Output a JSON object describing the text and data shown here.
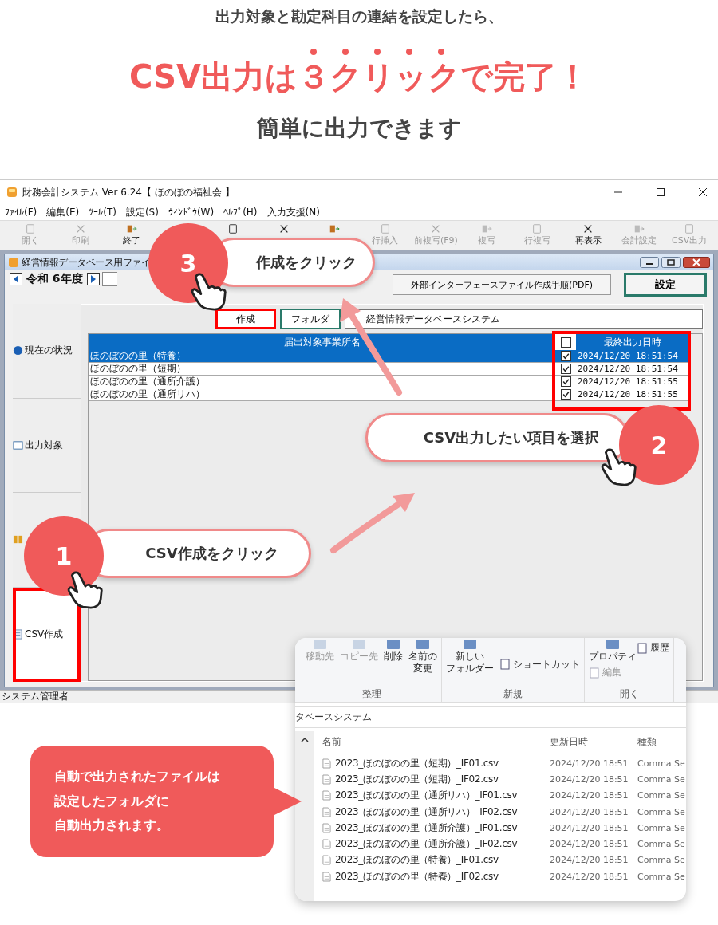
{
  "header": {
    "lead": "出力対象と勘定科目の連結を設定したら、",
    "title_parts": [
      {
        "text": "CSV出力は",
        "emphasis": false
      },
      {
        "text": "３クリック",
        "emphasis": true
      },
      {
        "text": "で完了！",
        "emphasis": false
      }
    ],
    "subtitle": "簡単に出力できます"
  },
  "app": {
    "title": "財務会計システム Ver 6.24【 ほのぼの福祉会 】",
    "menus": [
      "ﾌｧｲﾙ(F)",
      "編集(E)",
      "ﾂｰﾙ(T)",
      "設定(S)",
      "ｳｨﾝﾄﾞｳ(W)",
      "ﾍﾙﾌﾟ(H)",
      "入力支援(N)"
    ],
    "toolbar": [
      {
        "label": "開く",
        "disabled": true
      },
      {
        "label": "印刷",
        "disabled": true
      },
      {
        "label": "終了",
        "disabled": false
      },
      {
        "disabled": false
      },
      {
        "disabled": false
      },
      {
        "disabled": false
      },
      {
        "label": "行挿入",
        "disabled": true
      },
      {
        "label": "前複写(F9)",
        "disabled": true
      },
      {
        "label": "複写",
        "disabled": true
      },
      {
        "label": "行複写",
        "disabled": true
      },
      {
        "label": "再表示",
        "disabled": false
      },
      {
        "label": "会計設定",
        "disabled": true
      },
      {
        "label": "CSV出力",
        "disabled": true
      }
    ],
    "status": "システム管理者"
  },
  "child": {
    "title": "経営情報データベース用ファイ",
    "year": "令和 6年度",
    "pdf_button": "外部インターフェースファイル作成手順(PDF)",
    "settings_button": "設定",
    "sidebar": [
      {
        "label": "現在の状況",
        "selected": false,
        "highlighted": false
      },
      {
        "label": "出力対象",
        "selected": false,
        "highlighted": false
      },
      {
        "selected": false,
        "highlighted": false
      },
      {
        "label": "CSV作成",
        "selected": true,
        "highlighted": true
      }
    ],
    "actions": [
      {
        "label": "作成",
        "highlighted": true
      },
      {
        "label": "フォルダ",
        "highlighted": false
      }
    ],
    "folder_path": "経営情報データベースシステム",
    "table": {
      "columns": [
        "届出対象事業所名",
        "最終出力日時"
      ],
      "all_checked": false,
      "output_columns_highlighted": true,
      "rows": [
        {
          "name": "ほのぼのの里（特養）",
          "checked": true,
          "date": "2024/12/20 18:51:54",
          "selected": true
        },
        {
          "name": "ほのぼのの里（短期）",
          "checked": true,
          "date": "2024/12/20 18:51:54",
          "selected": false
        },
        {
          "name": "ほのぼのの里（通所介護）",
          "checked": true,
          "date": "2024/12/20 18:51:55",
          "selected": false
        },
        {
          "name": "ほのぼのの里（通所リハ）",
          "checked": true,
          "date": "2024/12/20 18:51:55",
          "selected": false
        }
      ]
    }
  },
  "steps": [
    {
      "number": "3",
      "text": "作成をクリック"
    },
    {
      "number": "2",
      "text": "CSV出力したい項目を選択"
    },
    {
      "number": "1",
      "text": "CSV作成をクリック"
    }
  ],
  "explorer": {
    "ribbon_groups": [
      {
        "label": "整理",
        "commands": [
          {
            "lines": [
              "移動先"
            ],
            "disabled": true,
            "kind": "large"
          },
          {
            "lines": [
              "コピー先"
            ],
            "disabled": true,
            "kind": "large"
          },
          {
            "lines": [
              "削除"
            ],
            "disabled": false,
            "kind": "large"
          },
          {
            "lines": [
              "名前の",
              "変更"
            ],
            "disabled": false,
            "kind": "large"
          }
        ]
      },
      {
        "label": "新規",
        "commands": [
          {
            "lines": [
              "新しい",
              "フォルダー"
            ],
            "disabled": false,
            "kind": "large"
          },
          {
            "lines": [
              "ショートカット"
            ],
            "disabled": false,
            "kind": "small"
          }
        ]
      },
      {
        "label": "開く",
        "commands": [
          {
            "lines": [
              "プロパティ"
            ],
            "disabled": false,
            "kind": "large"
          },
          {
            "lines": [
              "編集"
            ],
            "disabled": true,
            "kind": "small"
          },
          {
            "lines": [
              "履歴"
            ],
            "disabled": false,
            "kind": "small"
          }
        ]
      }
    ],
    "address": "タベースシステム",
    "columns": [
      "名前",
      "更新日時",
      "種類"
    ],
    "files": [
      {
        "name": "2023_ほのぼのの里（短期）_IF01.csv",
        "modified": "2024/12/20 18:51",
        "type": "Comma Se"
      },
      {
        "name": "2023_ほのぼのの里（短期）_IF02.csv",
        "modified": "2024/12/20 18:51",
        "type": "Comma Se"
      },
      {
        "name": "2023_ほのぼのの里（通所リハ）_IF01.csv",
        "modified": "2024/12/20 18:51",
        "type": "Comma Se"
      },
      {
        "name": "2023_ほのぼのの里（通所リハ）_IF02.csv",
        "modified": "2024/12/20 18:51",
        "type": "Comma Se"
      },
      {
        "name": "2023_ほのぼのの里（通所介護）_IF01.csv",
        "modified": "2024/12/20 18:51",
        "type": "Comma Se"
      },
      {
        "name": "2023_ほのぼのの里（通所介護）_IF02.csv",
        "modified": "2024/12/20 18:51",
        "type": "Comma Se"
      },
      {
        "name": "2023_ほのぼのの里（特養）_IF01.csv",
        "modified": "2024/12/20 18:51",
        "type": "Comma Se"
      },
      {
        "name": "2023_ほのぼのの里（特養）_IF02.csv",
        "modified": "2024/12/20 18:51",
        "type": "Comma Se"
      }
    ]
  },
  "note": {
    "lines": [
      "自動で出力されたファイルは",
      "設定したフォルダに",
      "自動出力されます。"
    ]
  }
}
